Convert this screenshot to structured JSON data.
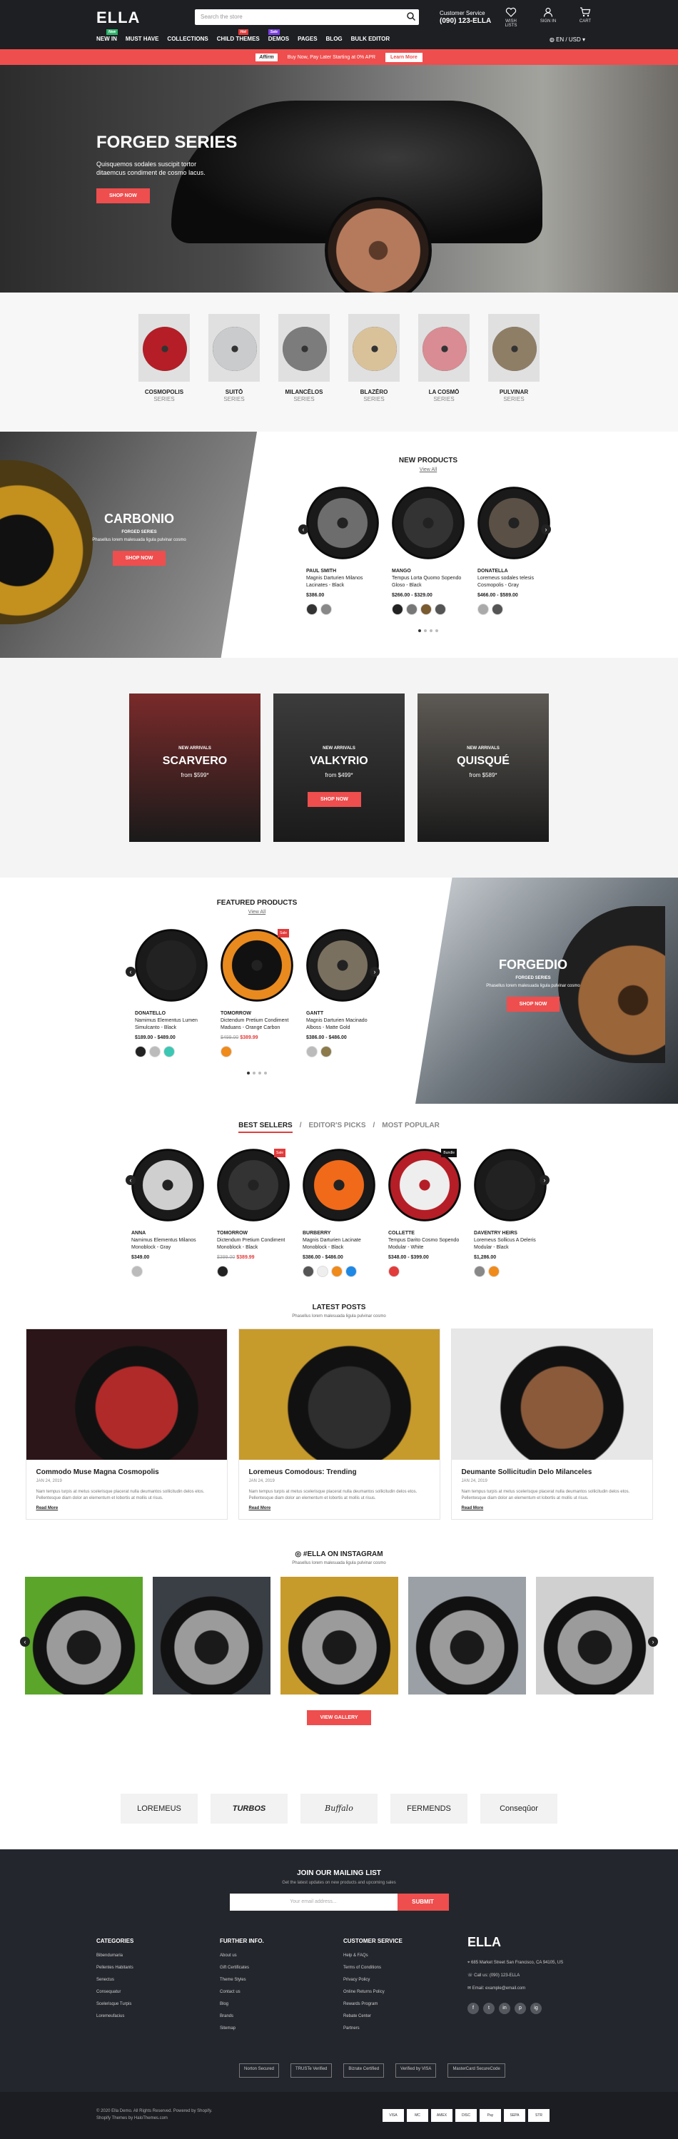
{
  "header": {
    "logo": "ELLA",
    "search_placeholder": "Search the store",
    "cs_label": "Customer Service",
    "cs_phone": "(090) 123-ELLA",
    "wishlist": "WISH LISTS",
    "signin": "SIGN IN",
    "cart": "CART",
    "cart_count": "0",
    "nav": [
      {
        "label": "NEW IN",
        "tag": "New",
        "tag_color": "#2db36b"
      },
      {
        "label": "MUST HAVE"
      },
      {
        "label": "COLLECTIONS"
      },
      {
        "label": "CHILD THEMES",
        "tag": "Hot",
        "tag_color": "#e23b3b"
      },
      {
        "label": "DEMOS",
        "tag": "Sale",
        "tag_color": "#7b3fe4"
      },
      {
        "label": "PAGES"
      },
      {
        "label": "BLOG"
      },
      {
        "label": "BULK EDITOR"
      }
    ],
    "lang": "EN / USD"
  },
  "promo": {
    "brand": "Affirm",
    "text": "Buy Now, Pay Later Starting at 0% APR",
    "button": "Learn More"
  },
  "hero": {
    "title": "FORGED SERIES",
    "text": "Quisquemos sodales suscipit tortor ditaemcus condiment de cosmo lacus.",
    "button": "SHOP NOW"
  },
  "series": [
    {
      "name": "COSMOPOLIS",
      "sub": "SERIES",
      "color": "#b51e26"
    },
    {
      "name": "SUITŌ",
      "sub": "SERIES",
      "color": "#c9cbcd"
    },
    {
      "name": "MILANCĒLOS",
      "sub": "SERIES",
      "color": "#7c7c7c"
    },
    {
      "name": "BLAZĒRO",
      "sub": "SERIES",
      "color": "#d9c29a"
    },
    {
      "name": "LA COSMŌ",
      "sub": "SERIES",
      "color": "#d98c93"
    },
    {
      "name": "PULVINAR",
      "sub": "SERIES",
      "color": "#8f7e66"
    }
  ],
  "carbonio": {
    "title": "CARBONIO",
    "sub": "FORGED SERIES",
    "text": "Phasellus lorem malesuada ligula pulvinar cosmo",
    "button": "SHOP NOW"
  },
  "new_products": {
    "title": "NEW PRODUCTS",
    "view_all": "View All",
    "items": [
      {
        "name": "PAUL SMITH",
        "desc": "Magnis Darturien Milanos Lacinates - Black",
        "price": "$386.00",
        "swatches": [
          "#333",
          "#888"
        ]
      },
      {
        "name": "MANGO",
        "desc": "Tempus Lorta Quomo Sopendo Gloso - Black",
        "price": "$266.00 - $329.00",
        "swatches": [
          "#222",
          "#777",
          "#7a5a2f",
          "#555"
        ]
      },
      {
        "name": "DONATELLA",
        "desc": "Loremeus sodales telesis Cosmopolis - Gray",
        "price": "$466.00 - $589.00",
        "swatches": [
          "#aaa",
          "#555"
        ]
      }
    ]
  },
  "categories": [
    {
      "sub": "NEW ARRIVALS",
      "title": "SCARVERO",
      "price": "from $599*",
      "bg": "#7a2a2a"
    },
    {
      "sub": "NEW ARRIVALS",
      "title": "VALKYRIO",
      "price": "from $499*",
      "button": "SHOP NOW",
      "bg": "#3c3c3c"
    },
    {
      "sub": "NEW ARRIVALS",
      "title": "QUISQUÉ",
      "price": "from $589*",
      "bg": "#5e5a55"
    }
  ],
  "featured": {
    "title": "FEATURED PRODUCTS",
    "view_all": "View All",
    "items": [
      {
        "name": "DONATELLO",
        "desc": "Namimus Elementus Lumen Simulcanto - Black",
        "price": "$189.00 - $489.00",
        "swatches": [
          "#222",
          "#bbb",
          "#3cc7b4"
        ]
      },
      {
        "name": "TOMORROW",
        "desc": "Dictendum Pretium Condiment Maduans - Orange Carbon",
        "old": "$499.00",
        "sale": "$389.99",
        "badge": "Sale",
        "swatches": [
          "#f08a1a"
        ]
      },
      {
        "name": "GANTT",
        "desc": "Magnis Darturien Macinado Alboss - Matte Gold",
        "price": "$386.00 - $486.00",
        "swatches": [
          "#bbb",
          "#8c7a4b"
        ]
      }
    ]
  },
  "forgedio": {
    "title": "FORGEDIO",
    "sub": "FORGED SERIES",
    "text": "Phasellus lorem malesuada ligula pulvinar cosmo",
    "button": "SHOP NOW"
  },
  "tabs": {
    "items": [
      "BEST SELLERS",
      "EDITOR'S PICKS",
      "MOST POPULAR"
    ],
    "sep": "/",
    "products": [
      {
        "name": "ANNA",
        "desc": "Namimus Elementus Milanos Monoblock - Gray",
        "price": "$349.00",
        "swatches": [
          "#bbb"
        ]
      },
      {
        "name": "TOMORROW",
        "desc": "Dictendum Pretium Condiment Monoblock - Black",
        "old": "$399.00",
        "sale": "$389.99",
        "badge": "Sale",
        "swatches": [
          "#222"
        ]
      },
      {
        "name": "BURBERRY",
        "desc": "Magnis Darturien Lacinate Monoblock - Black",
        "price": "$386.00 - $486.00",
        "swatches": [
          "#555",
          "#eee",
          "#f08a1a",
          "#1e88e5"
        ]
      },
      {
        "name": "COLLETTE",
        "desc": "Tempus Darito Cosmo Sopendo Modular - White",
        "price": "$348.00 - $399.00",
        "badge": "Bundle",
        "swatches": [
          "#e23b3b"
        ]
      },
      {
        "name": "DAVENTRY HEIRS",
        "desc": "Loremeus Sollicus A Deleris Modular - Black",
        "price": "$1,286.00",
        "swatches": [
          "#888",
          "#f08a1a"
        ]
      }
    ]
  },
  "posts": {
    "title": "LATEST POSTS",
    "sub": "Phasellus lorem malesuada ligula pulvinar cosmo",
    "items": [
      {
        "title": "Commodo Muse Magna Cosmopolis",
        "date": "JAN 24, 2019",
        "excerpt": "Nam tempus turpis at metus scelerisque placerat nulla deumantos sollicitudin delos etos. Pellentesque diam dolor an elementum et lobortis at mollis ut risus.",
        "more": "Read More",
        "c1": "#2b1518",
        "c2": "#b02a2a"
      },
      {
        "title": "Loremeus Comodous: Trending",
        "date": "JAN 24, 2019",
        "excerpt": "Nam tempus turpis at metus scelerisque placerat nulla deumantos sollicitudin delos etos. Pellentesque diam dolor an elementum et lobortis at mollis ut risus.",
        "more": "Read More",
        "c1": "#c79a2c",
        "c2": "#2e2e2e"
      },
      {
        "title": "Deumante Sollicitudin Delo Milanceles",
        "date": "JAN 24, 2019",
        "excerpt": "Nam tempus turpis at metus scelerisque placerat nulla deumantos sollicitudin delos etos. Pellentesque diam dolor an elementum et lobortis at mollis ut risus.",
        "more": "Read More",
        "c1": "#e7e7e7",
        "c2": "#8a5a3b"
      }
    ]
  },
  "instagram": {
    "title": "#ELLA ON INSTAGRAM",
    "sub": "Phasellus lorem malesuada ligula pulvinar cosmo",
    "button": "VIEW GALLERY",
    "tiles": [
      "#5aa52a",
      "#3a3f45",
      "#c79a2c",
      "#9aa0a5",
      "#d0d0d0"
    ]
  },
  "brands": [
    "LOREMEUS",
    "TURBOS",
    "Buffalo",
    "FERMENDS",
    "Conseqûor"
  ],
  "footer": {
    "mailing_title": "JOIN OUR MAILING LIST",
    "mailing_sub": "Get the latest updates on new products and upcoming sales",
    "email_placeholder": "Your email address...",
    "submit": "SUBMIT",
    "columns": [
      {
        "title": "CATEGORIES",
        "links": [
          "Bibendumaria",
          "Pellentes Habitants",
          "Senectus",
          "Consequatur",
          "Scelerisque Turpis",
          "Loremeufacius"
        ]
      },
      {
        "title": "FURTHER INFO.",
        "links": [
          "About us",
          "Gift Certificates",
          "Theme Styles",
          "Contact us",
          "Blog",
          "Brands",
          "Sitemap"
        ]
      },
      {
        "title": "CUSTOMER SERVICE",
        "links": [
          "Help & FAQs",
          "Terms of Conditions",
          "Privacy Policy",
          "Online Returns Policy",
          "Rewards Program",
          "Rebate Center",
          "Partners"
        ]
      }
    ],
    "logo": "ELLA",
    "address": "685 Market Street San Francisco, CA 94105, US",
    "phone": "Call us: (090) 123-ELLA",
    "email": "Email: example@email.com",
    "social": [
      "f",
      "t",
      "in",
      "p",
      "ig"
    ],
    "seals": [
      "Norton Secured",
      "TRUSTe Verified",
      "Bizrate Certified",
      "Verified by VISA",
      "MasterCard SecureCode"
    ],
    "copyright": "© 2020 Ella Demo. All Rights Reserved. Powered by Shopify.",
    "credit": "Shopify Themes by HaloThemes.com",
    "payments": [
      "VISA",
      "MC",
      "AMEX",
      "DISC",
      "Pay",
      "SEPA",
      "STR"
    ]
  }
}
